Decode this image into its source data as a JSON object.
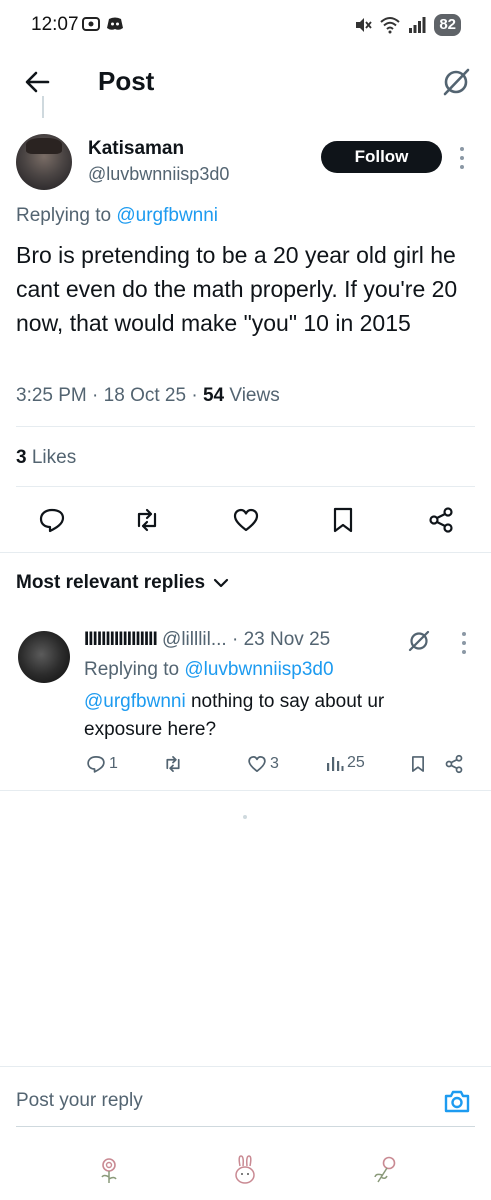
{
  "status_bar": {
    "time": "12:07",
    "battery": "82"
  },
  "header": {
    "title": "Post"
  },
  "post": {
    "display_name": "Katisaman",
    "handle": "@luvbwnniisp3d0",
    "follow_label": "Follow",
    "replying_prefix": "Replying to ",
    "replying_to": "@urgfbwnni",
    "text": "Bro is pretending to be a 20 year old girl he cant even do the math properly. If you're 20 now, that would make \"you\" 10 in 2015",
    "time": "3:25 PM",
    "date": "18 Oct 25",
    "views_count": "54",
    "views_label": "Views",
    "likes_count": "3",
    "likes_label": "Likes"
  },
  "replies_sort": {
    "label": "Most relevant replies"
  },
  "reply": {
    "display_name": "IIIIIIIIIIIIIIIII",
    "handle": "@lilllil...",
    "date": "· 23 Nov 25",
    "replying_prefix": "Replying to ",
    "replying_to": "@luvbwnniisp3d0",
    "mention": "@urgfbwnni",
    "text": " nothing to say about ur exposure here?",
    "reply_count": "1",
    "like_count": "3",
    "view_count": "25"
  },
  "composer": {
    "placeholder": "Post your reply"
  },
  "colors": {
    "accent": "#1d9bf0",
    "text_primary": "#0f1419",
    "text_secondary": "#536471"
  }
}
